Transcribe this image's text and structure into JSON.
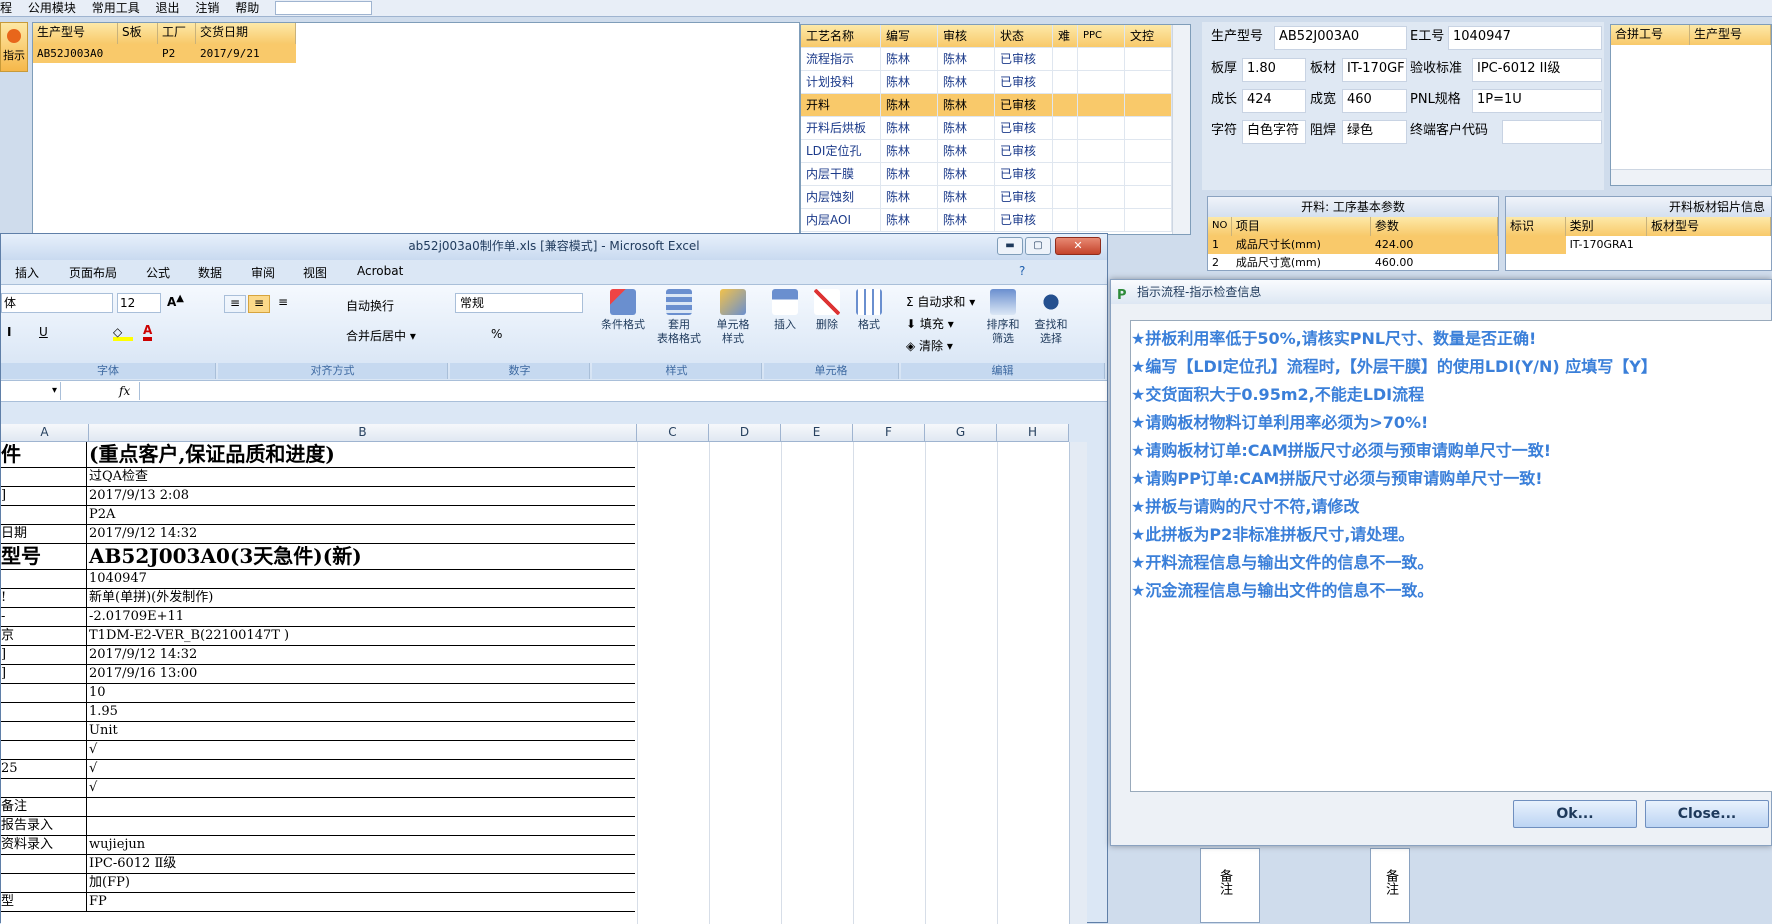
{
  "menu": {
    "items": [
      "程",
      "公用模块",
      "常用工具",
      "退出",
      "注销",
      "帮助"
    ]
  },
  "side_btn": {
    "label": "指示"
  },
  "orders": {
    "headers": [
      "生产型号",
      "S板",
      "工厂",
      "交货日期"
    ],
    "rows": [
      [
        "AB52J003A0",
        "",
        "P2",
        "2017/9/21"
      ]
    ]
  },
  "process": {
    "headers": [
      "工艺名称",
      "编写",
      "审核",
      "状态",
      "难",
      "PPC",
      "文控"
    ],
    "rows": [
      [
        "流程指示",
        "陈林",
        "陈林",
        "已审核"
      ],
      [
        "计划投料",
        "陈林",
        "陈林",
        "已审核"
      ],
      [
        "开料",
        "陈林",
        "陈林",
        "已审核"
      ],
      [
        "开料后烘板",
        "陈林",
        "陈林",
        "已审核"
      ],
      [
        "LDI定位孔",
        "陈林",
        "陈林",
        "已审核"
      ],
      [
        "内层干膜",
        "陈林",
        "陈林",
        "已审核"
      ],
      [
        "内层蚀刻",
        "陈林",
        "陈林",
        "已审核"
      ],
      [
        "内层AOI",
        "陈林",
        "陈林",
        "已审核"
      ]
    ]
  },
  "info": {
    "l_model": "生产型号",
    "model": "AB52J003A0",
    "l_eno": "E工号",
    "eno": "1040947",
    "l_thick": "板厚",
    "thick": "1.80",
    "l_mat": "板材",
    "mat": "IT-170GF",
    "l_std": "验收标准",
    "std": "IPC-6012 II级",
    "l_len": "成长",
    "len": "424",
    "l_wid": "成宽",
    "wid": "460",
    "l_pnl": "PNL规格",
    "pnl": "1P=1U",
    "l_char": "字符",
    "char": "白色字符",
    "l_mask": "阻焊",
    "mask": "绿色",
    "l_cust": "终端客户代码",
    "cust": ""
  },
  "merge": {
    "headers": [
      "合拼工号",
      "生产型号"
    ]
  },
  "basic": {
    "title": "开料: 工序基本参数",
    "headers": [
      "NO",
      "项目",
      "参数"
    ],
    "rows": [
      [
        "1",
        "成品尺寸长(mm)",
        "424.00"
      ],
      [
        "2",
        "成品尺寸宽(mm)",
        "460.00"
      ]
    ]
  },
  "sheetinfo": {
    "title": "开料板材铝片信息",
    "headers": [
      "标识",
      "类别",
      "板材型号"
    ],
    "rows": [
      [
        "",
        "IT-170GRA1",
        ""
      ]
    ]
  },
  "side_notes": {
    "a": "备注",
    "b": "备注"
  },
  "excel": {
    "title": "ab52j003a0制作单.xls [兼容模式] - Microsoft Excel",
    "tabs": [
      "插入",
      "页面布局",
      "公式",
      "数据",
      "审阅",
      "视图",
      "Acrobat"
    ],
    "font_name": "体",
    "font_size": "12",
    "number_format": "常规",
    "wrap": "自动换行",
    "merge_center": "合并后居中",
    "autosum": "自动求和",
    "fill": "填充",
    "clear": "清除",
    "groups": [
      "字体",
      "对齐方式",
      "数字",
      "样式",
      "单元格",
      "编辑"
    ],
    "btns": {
      "cond": "条件格式",
      "table": "套用\n表格格式",
      "cellstyle": "单元格\n样式",
      "insert": "插入",
      "delete": "删除",
      "format": "格式",
      "sort": "排序和\n筛选",
      "find": "查找和\n选择"
    },
    "fx": "fx",
    "cols": [
      "A",
      "B",
      "C",
      "D",
      "E",
      "F",
      "G",
      "H"
    ],
    "rows": [
      [
        "件",
        "(重点客户,保证品质和进度)"
      ],
      [
        "",
        "过QA检查"
      ],
      [
        "]",
        "2017/9/13 2:08"
      ],
      [
        "",
        "P2A"
      ],
      [
        "日期",
        "2017/9/12 14:32"
      ],
      [
        "型号",
        "AB52J003A0(3天急件)(新)"
      ],
      [
        "",
        "1040947"
      ],
      [
        "!",
        "新单(单拼)(外发制作)"
      ],
      [
        "-",
        "-2.01709E+11"
      ],
      [
        "京",
        "T1DM-E2-VER_B(22100147T )"
      ],
      [
        "]",
        "2017/9/12 14:32"
      ],
      [
        "]",
        "2017/9/16 13:00"
      ],
      [
        "",
        "10"
      ],
      [
        "",
        "1.95"
      ],
      [
        "",
        "Unit"
      ],
      [
        "",
        "√"
      ],
      [
        "25",
        "√"
      ],
      [
        "",
        "√"
      ],
      [
        "备注",
        ""
      ],
      [
        "报告录入",
        ""
      ],
      [
        "资料录入",
        "wujiejun"
      ],
      [
        "",
        "IPC-6012 Ⅱ级"
      ],
      [
        "",
        "加(FP)"
      ],
      [
        "型",
        "FP"
      ]
    ]
  },
  "dialog": {
    "title": "指示流程-指示检查信息",
    "messages": [
      "★拼板利用率低于50%,请核实PNL尺寸、数量是否正确!",
      "★编写【LDI定位孔】流程时,【外层干膜】的使用LDI(Y/N) 应填写【Y】",
      "★交货面积大于0.95m2,不能走LDI流程",
      "★请购板材物料订单利用率必须为>70%!",
      "★请购板材订单:CAM拼版尺寸必须与预审请购单尺寸一致!",
      "★请购PP订单:CAM拼版尺寸必须与预审请购单尺寸一致!",
      "★拼板与请购的尺寸不符,请修改",
      "★此拼板为P2非标准拼板尺寸,请处理。",
      "★开料流程信息与输出文件的信息不一致。",
      "★沉金流程信息与输出文件的信息不一致。"
    ],
    "ok": "Ok...",
    "close": "Close..."
  },
  "colors": {
    "accent": "#f9c96a",
    "msg": "#3a7fd9"
  }
}
